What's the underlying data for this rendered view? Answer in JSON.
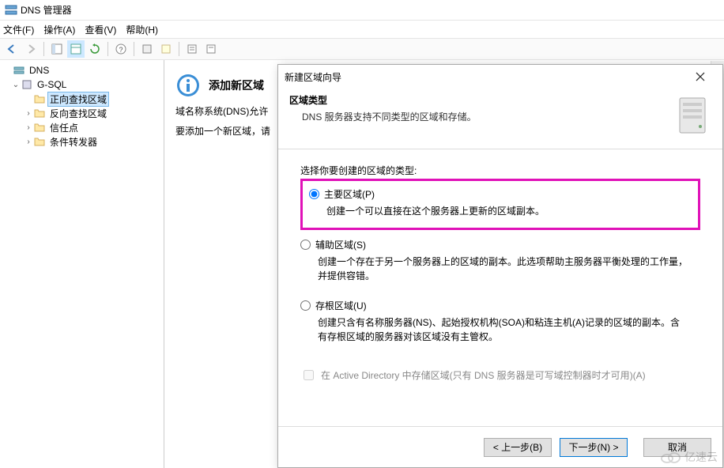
{
  "window": {
    "title": "DNS 管理器"
  },
  "menu": {
    "file": "文件(F)",
    "action": "操作(A)",
    "view": "查看(V)",
    "help": "帮助(H)"
  },
  "tree": {
    "root": "DNS",
    "server": "G-SQL",
    "fwd": "正向查找区域",
    "rev": "反向查找区域",
    "trust": "信任点",
    "cond": "条件转发器"
  },
  "content": {
    "heading": "添加新区域",
    "p1": "域名称系统(DNS)允许",
    "p2": "要添加一个新区域，请"
  },
  "dialog": {
    "title": "新建区域向导",
    "section_title": "区域类型",
    "section_sub": "DNS 服务器支持不同类型的区域和存储。",
    "prompt": "选择你要创建的区域的类型:",
    "opt1_label": "主要区域(P)",
    "opt1_desc": "创建一个可以直接在这个服务器上更新的区域副本。",
    "opt2_label": "辅助区域(S)",
    "opt2_desc": "创建一个存在于另一个服务器上的区域的副本。此选项帮助主服务器平衡处理的工作量，并提供容错。",
    "opt3_label": "存根区域(U)",
    "opt3_desc": "创建只含有名称服务器(NS)、起始授权机构(SOA)和粘连主机(A)记录的区域的副本。含有存根区域的服务器对该区域没有主管权。",
    "ad_label": "在 Active Directory 中存储区域(只有 DNS 服务器是可写域控制器时才可用)(A)",
    "btn_back": "< 上一步(B)",
    "btn_next": "下一步(N) >",
    "btn_cancel": "取消"
  },
  "watermark": "亿速云"
}
